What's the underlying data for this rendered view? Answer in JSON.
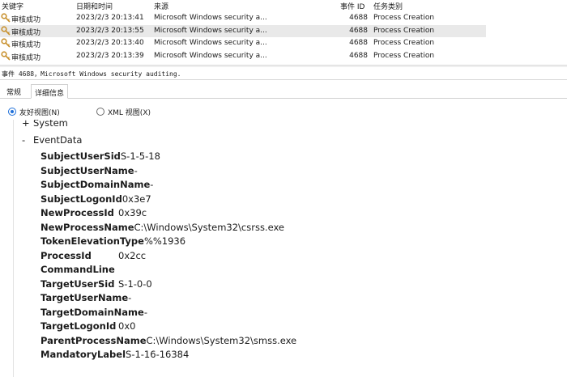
{
  "grid": {
    "headers": {
      "keyword": "关键字",
      "datetime": "日期和时间",
      "source": "来源",
      "event_id": "事件 ID",
      "category": "任务类别"
    },
    "rows": [
      {
        "keyword": "审核成功",
        "datetime": "2023/2/3 20:13:41",
        "source": "Microsoft Windows security a...",
        "event_id": "4688",
        "category": "Process Creation",
        "selected": false
      },
      {
        "keyword": "审核成功",
        "datetime": "2023/2/3 20:13:55",
        "source": "Microsoft Windows security a...",
        "event_id": "4688",
        "category": "Process Creation",
        "selected": true
      },
      {
        "keyword": "审核成功",
        "datetime": "2023/2/3 20:13:40",
        "source": "Microsoft Windows security a...",
        "event_id": "4688",
        "category": "Process Creation",
        "selected": false
      },
      {
        "keyword": "审核成功",
        "datetime": "2023/2/3 20:13:39",
        "source": "Microsoft Windows security a...",
        "event_id": "4688",
        "category": "Process Creation",
        "selected": false
      }
    ]
  },
  "event_title": "事件 4688，Microsoft Windows security auditing.",
  "tabs": {
    "general": "常规",
    "details": "详细信息"
  },
  "view": {
    "friendly": "友好视图(N)",
    "xml": "XML 视图(X)"
  },
  "tree": {
    "system": {
      "sign": "+",
      "label": "System"
    },
    "eventdata": {
      "sign": "-",
      "label": "EventData"
    }
  },
  "fields": [
    {
      "name": "SubjectUserSid",
      "value": "S-1-5-18"
    },
    {
      "name": "SubjectUserName",
      "value": "-"
    },
    {
      "name": "SubjectDomainName",
      "value": "-"
    },
    {
      "name": "SubjectLogonId",
      "value": "0x3e7"
    },
    {
      "name": "NewProcessId",
      "value": "0x39c"
    },
    {
      "name": "NewProcessName",
      "value": "C:\\Windows\\System32\\csrss.exe"
    },
    {
      "name": "TokenElevationType",
      "value": "%%1936"
    },
    {
      "name": "ProcessId",
      "value": "0x2cc"
    },
    {
      "name": "CommandLine",
      "value": ""
    },
    {
      "name": "TargetUserSid",
      "value": "S-1-0-0"
    },
    {
      "name": "TargetUserName",
      "value": "-"
    },
    {
      "name": "TargetDomainName",
      "value": "-"
    },
    {
      "name": "TargetLogonId",
      "value": "0x0"
    },
    {
      "name": "ParentProcessName",
      "value": "C:\\Windows\\System32\\smss.exe"
    },
    {
      "name": "MandatoryLabel",
      "value": "S-1-16-16384"
    }
  ],
  "colors": {
    "selected_row": "#e9e9e9",
    "radio_accent": "#1e6fd9",
    "key_icon": "#c8912e"
  }
}
